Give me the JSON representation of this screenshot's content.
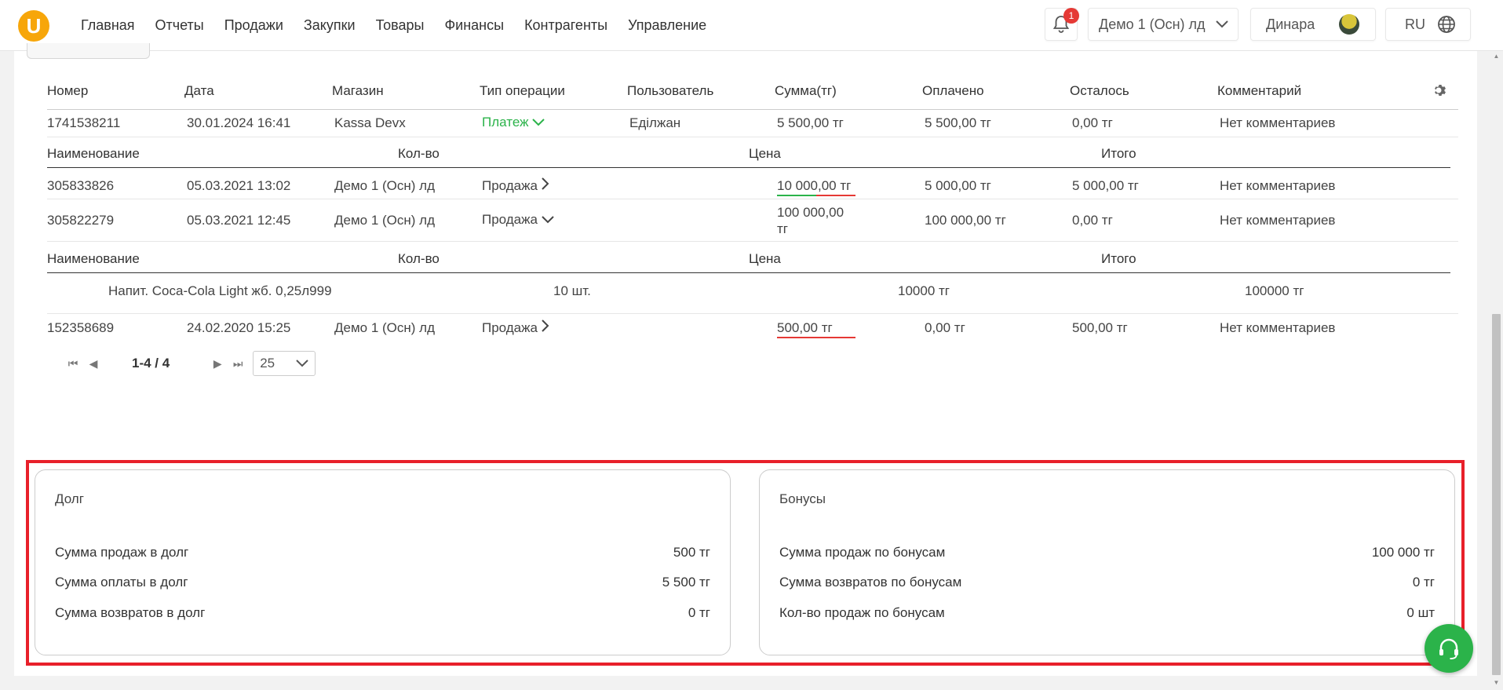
{
  "header": {
    "logo": "U",
    "nav": [
      "Главная",
      "Отчеты",
      "Продажи",
      "Закупки",
      "Товары",
      "Финансы",
      "Контрагенты",
      "Управление"
    ],
    "notifications_count": "1",
    "store": "Демо 1 (Осн) лд",
    "user": "Динара",
    "lang": "RU"
  },
  "table": {
    "headers": [
      "Номер",
      "Дата",
      "Магазин",
      "Тип операции",
      "Пользователь",
      "Сумма(тг)",
      "Оплачено",
      "Осталось",
      "Комментарий"
    ],
    "rows": [
      {
        "num": "1741538211",
        "date": "30.01.2024 16:41",
        "store": "Kassa Devx",
        "type": "Платеж",
        "user": "Еділжан",
        "sum": "5 500,00 тг",
        "paid": "5 500,00 тг",
        "left": "0,00 тг",
        "comment": "Нет комментариев"
      },
      {
        "num": "305833826",
        "date": "05.03.2021 13:02",
        "store": "Демо 1 (Осн) лд",
        "type": "Продажа",
        "user": "",
        "sum": "10 000,00 тг",
        "paid": "5 000,00 тг",
        "left": "5 000,00 тг",
        "comment": "Нет комментариев"
      },
      {
        "num": "305822279",
        "date": "05.03.2021 12:45",
        "store": "Демо 1 (Осн) лд",
        "type": "Продажа",
        "user": "",
        "sum": "100 000,00",
        "sum2": "тг",
        "paid": "100 000,00 тг",
        "left": "0,00 тг",
        "comment": "Нет комментариев"
      },
      {
        "num": "152358689",
        "date": "24.02.2020 15:25",
        "store": "Демо 1 (Осн) лд",
        "type": "Продажа",
        "user": "",
        "sum": "500,00 тг",
        "paid": "0,00 тг",
        "left": "500,00 тг",
        "comment": "Нет комментариев"
      }
    ],
    "sub_headers": [
      "Наименование",
      "Кол-во",
      "Цена",
      "Итого"
    ],
    "sub_item": {
      "name": "Напит. Coca-Cola Light жб. 0,25л999",
      "qty": "10 шт.",
      "price": "10000 тг",
      "total": "100000 тг"
    }
  },
  "pager": {
    "range": "1-4 / 4",
    "per_page": "25"
  },
  "debt": {
    "title": "Долг",
    "rows": [
      {
        "label": "Сумма продаж в долг",
        "value": "500 тг"
      },
      {
        "label": "Сумма оплаты в долг",
        "value": "5 500 тг"
      },
      {
        "label": "Сумма возвратов в долг",
        "value": "0 тг"
      }
    ]
  },
  "bonus": {
    "title": "Бонусы",
    "rows": [
      {
        "label": "Сумма продаж по бонусам",
        "value": "100 000 тг"
      },
      {
        "label": "Сумма возвратов по бонусам",
        "value": "0 тг"
      },
      {
        "label": "Кол-во продаж по бонусам",
        "value": "0 шт"
      }
    ]
  },
  "colors": {
    "accent": "#f7a60a",
    "green": "#2bb34a",
    "red": "#e53935",
    "highlight": "#e8202a"
  }
}
